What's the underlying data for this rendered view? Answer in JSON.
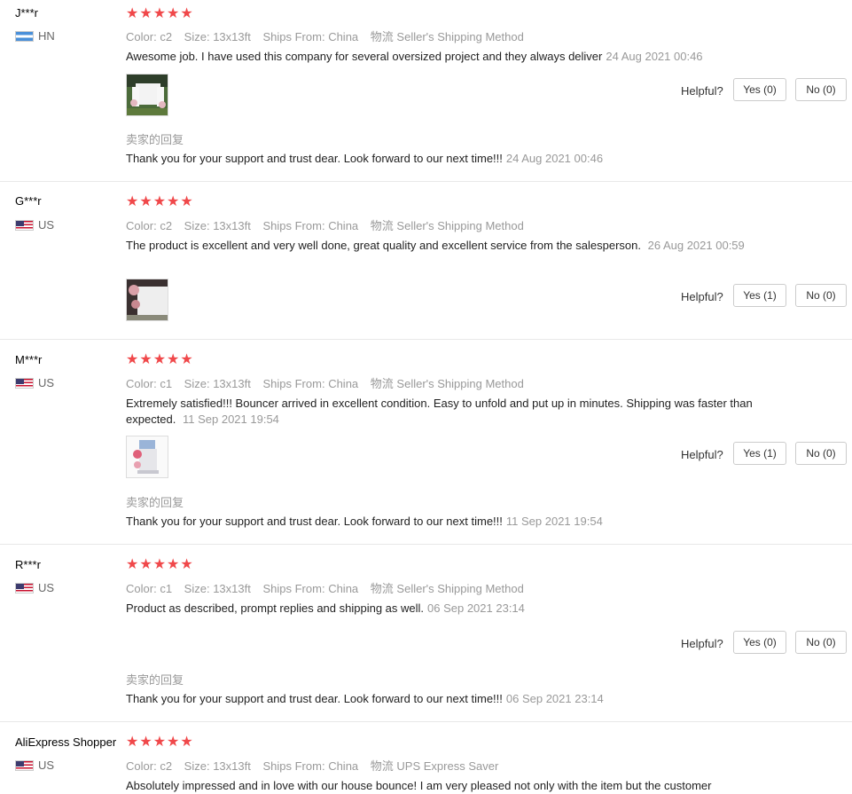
{
  "labels": {
    "color": "Color:",
    "size": "Size:",
    "ships_from": "Ships From:",
    "logistics": "物流",
    "helpful": "Helpful?",
    "reply_label": "卖家的回复",
    "rating_stars": "★★★★★"
  },
  "reviews": [
    {
      "user": "J***r",
      "country": "HN",
      "flag": "flag-hn",
      "color": "c2",
      "size": "13x13ft",
      "ships_from": "China",
      "shipping": "Seller's Shipping Method",
      "text": "Awesome job. I have used this company for several oversized project and they always deliver",
      "date": "24 Aug 2021 00:46",
      "yes": "Yes (0)",
      "no": "No (0)",
      "reply": "Thank you for your support and trust dear. Look forward to our next time!!!",
      "reply_date": "24 Aug 2021 00:46"
    },
    {
      "user": "G***r",
      "country": "US",
      "flag": "flag-us",
      "color": "c2",
      "size": "13x13ft",
      "ships_from": "China",
      "shipping": "Seller's Shipping Method",
      "text": "The product is excellent and very well done, great quality and excellent service from the salesperson.",
      "date": "26 Aug 2021 00:59",
      "yes": "Yes (1)",
      "no": "No (0)"
    },
    {
      "user": "M***r",
      "country": "US",
      "flag": "flag-us",
      "color": "c1",
      "size": "13x13ft",
      "ships_from": "China",
      "shipping": "Seller's Shipping Method",
      "text": "Extremely satisfied!!! Bouncer arrived in excellent condition. Easy to unfold and put up in minutes. Shipping was faster than expected.",
      "date": "11 Sep 2021 19:54",
      "yes": "Yes (1)",
      "no": "No (0)",
      "reply": "Thank you for your support and trust dear. Look forward to our next time!!!",
      "reply_date": "11 Sep 2021 19:54"
    },
    {
      "user": "R***r",
      "country": "US",
      "flag": "flag-us",
      "color": "c1",
      "size": "13x13ft",
      "ships_from": "China",
      "shipping": "Seller's Shipping Method",
      "text": "Product as described, prompt replies and shipping as well.",
      "date": "06 Sep 2021 23:14",
      "yes": "Yes (0)",
      "no": "No (0)",
      "reply": "Thank you for your support and trust dear. Look forward to our next time!!!",
      "reply_date": "06 Sep 2021 23:14"
    },
    {
      "user": "AliExpress Shopper",
      "country": "US",
      "flag": "flag-us",
      "color": "c2",
      "size": "13x13ft",
      "ships_from": "China",
      "shipping": "UPS Express Saver",
      "text": "Absolutely impressed and in love with our house bounce! I am very pleased not only with the item but the customer"
    }
  ]
}
